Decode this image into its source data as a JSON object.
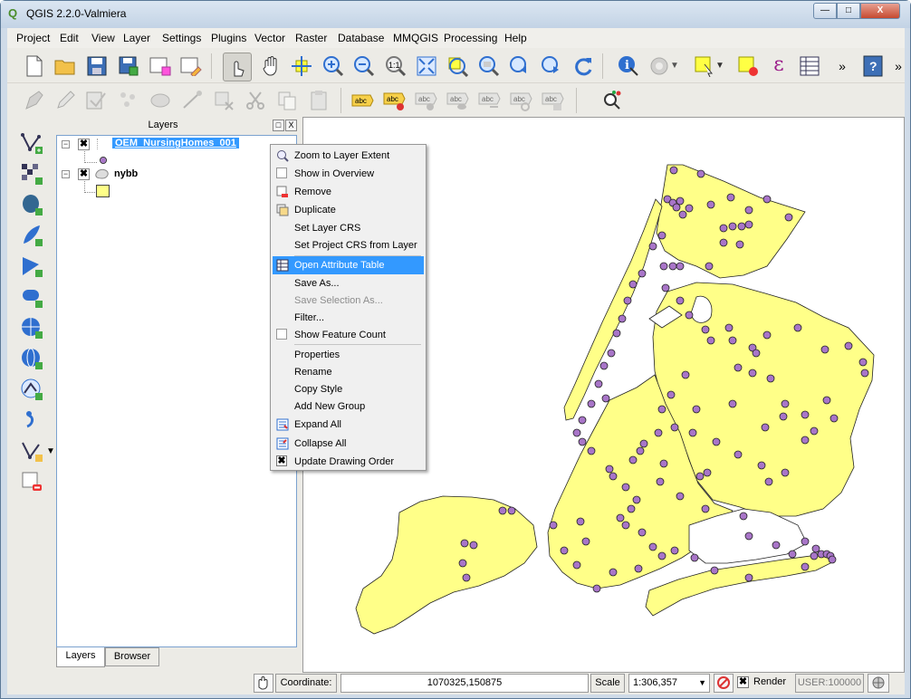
{
  "window": {
    "title": "QGIS 2.2.0-Valmiera",
    "minimize_glyph": "—",
    "maximize_glyph": "□",
    "close_glyph": "X",
    "icon": "qgis-icon"
  },
  "menubar": [
    "Project",
    "Edit",
    "View",
    "Layer",
    "Settings",
    "Plugins",
    "Vector",
    "Raster",
    "Database",
    "MMQGIS",
    "Processing",
    "Help"
  ],
  "toolbar": {
    "overflow": "»",
    "help": "?",
    "epsilon": "ε",
    "abc": "abc"
  },
  "layers_panel": {
    "title": "Layers",
    "float_glyph": "□",
    "close_glyph": "X",
    "layers": [
      {
        "name": "OEM_NursingHomes_001",
        "checked": "✖",
        "expand": "−",
        "symbol_color": "#a875c8"
      },
      {
        "name": "nybb",
        "checked": "✖",
        "expand": "−",
        "symbol_color": "#ffff88"
      }
    ]
  },
  "tabs": [
    "Layers",
    "Browser"
  ],
  "context_menu": {
    "items": [
      "Zoom to Layer Extent",
      "Show in Overview",
      "Remove",
      "Duplicate",
      "Set Layer CRS",
      "Set Project CRS from Layer",
      "Open Attribute Table",
      "Save As...",
      "Save Selection As...",
      "Filter...",
      "Show Feature Count",
      "Properties",
      "Rename",
      "Copy Style",
      "Add New Group",
      "Expand All",
      "Collapse All",
      "Update Drawing Order"
    ],
    "highlighted": "Open Attribute Table",
    "disabled": "Save Selection As...",
    "checked_mark": "✖"
  },
  "statusbar": {
    "coordinate_label": "Coordinate:",
    "coordinate_value": "1070325,150875",
    "scale_label": "Scale",
    "scale_value": "1:306,357",
    "render_label": "Render",
    "render_check": "✖",
    "user": "USER:100000"
  },
  "colors": {
    "land": "#ffff88",
    "points": "#a875c8",
    "highlight": "#3399ff"
  }
}
